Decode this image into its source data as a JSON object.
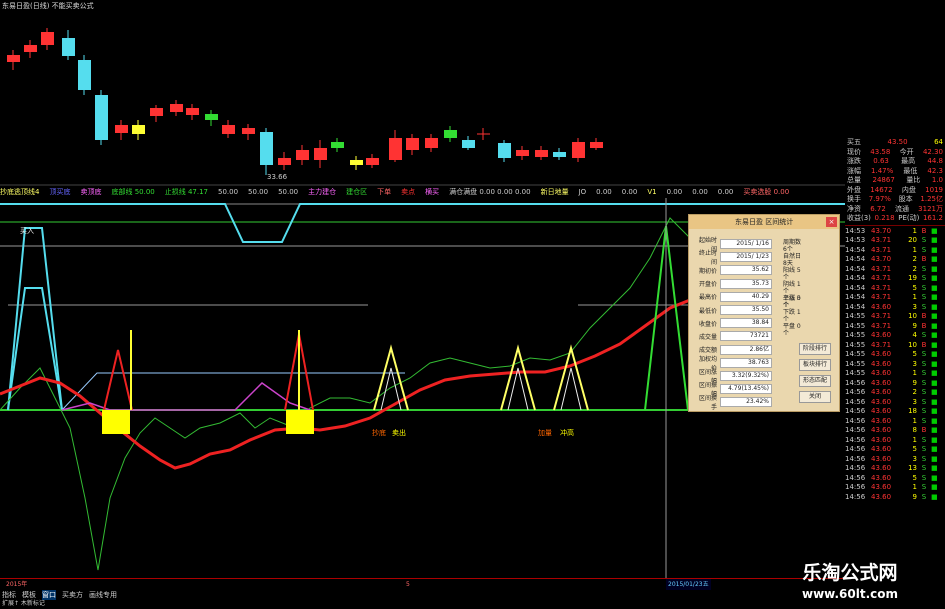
{
  "title": "东易日盈(日线) 不能买卖公式",
  "price_label_low": "33.66",
  "indicator_strip": [
    "抄底逃顶线4",
    "顶买底",
    "卖顶底",
    "底部线 50.00",
    "止损线 47.17",
    "50.00",
    "50.00",
    "50.00",
    "主力建仓",
    "建仓区",
    "下单",
    "卖点",
    "横买",
    "满仓满盘 0.00 0.00 0.00",
    "新日地量",
    "JO",
    "0.00",
    "0.00",
    "V1",
    "0.00",
    "0.00",
    "0.00",
    "买卖选股 0.00"
  ],
  "chart_labels": {
    "buy": "买入",
    "sell1": "抄底",
    "sell2": "卖出",
    "rise": "冲高",
    "lb1": "加量",
    "lb2": "冲高"
  },
  "quote": [
    {
      "k": "买五",
      "v": "43.50",
      "c": "64"
    },
    {
      "k": "现价",
      "v": "43.58",
      "k2": "今开",
      "v2": "42.30"
    },
    {
      "k": "涨跌",
      "v": "0.63",
      "k2": "最高",
      "v2": "44.8"
    },
    {
      "k": "涨幅",
      "v": "1.47%",
      "k2": "最低",
      "v2": "42.3"
    },
    {
      "k": "总量",
      "v": "24867",
      "k2": "量比",
      "v2": "1.0"
    },
    {
      "k": "外盘",
      "v": "14672",
      "k2": "内盘",
      "v2": "1019"
    },
    {
      "k": "换手",
      "v": "7.97%",
      "k2": "股本",
      "v2": "1.25亿"
    },
    {
      "k": "净资",
      "v": "6.72",
      "k2": "流通",
      "v2": "3121万"
    },
    {
      "k": "收益(3)",
      "v": "0.218",
      "k2": "PE(动)",
      "v2": "161.2"
    }
  ],
  "ticks": [
    [
      "14:53",
      "43.70",
      "1",
      "B"
    ],
    [
      "14:53",
      "43.71",
      "20",
      "S"
    ],
    [
      "14:54",
      "43.71",
      "1",
      "S"
    ],
    [
      "14:54",
      "43.70",
      "2",
      "B"
    ],
    [
      "14:54",
      "43.71",
      "2",
      "S"
    ],
    [
      "14:54",
      "43.71",
      "19",
      "S"
    ],
    [
      "14:54",
      "43.71",
      "5",
      "S"
    ],
    [
      "14:54",
      "43.71",
      "1",
      "S"
    ],
    [
      "14:54",
      "43.60",
      "3",
      "S"
    ],
    [
      "14:55",
      "43.71",
      "10",
      "B"
    ],
    [
      "14:55",
      "43.71",
      "9",
      "B"
    ],
    [
      "14:55",
      "43.60",
      "4",
      "S"
    ],
    [
      "14:55",
      "43.71",
      "10",
      "B"
    ],
    [
      "14:55",
      "43.60",
      "5",
      "S"
    ],
    [
      "14:55",
      "43.60",
      "3",
      "S"
    ],
    [
      "14:55",
      "43.60",
      "1",
      "S"
    ],
    [
      "14:56",
      "43.60",
      "9",
      "S"
    ],
    [
      "14:56",
      "43.60",
      "2",
      "S"
    ],
    [
      "14:56",
      "43.60",
      "3",
      "S"
    ],
    [
      "14:56",
      "43.60",
      "18",
      "S"
    ],
    [
      "14:56",
      "43.60",
      "1",
      "S"
    ],
    [
      "14:56",
      "43.60",
      "8",
      "B"
    ],
    [
      "14:56",
      "43.60",
      "1",
      "S"
    ],
    [
      "14:56",
      "43.60",
      "5",
      "S"
    ],
    [
      "14:56",
      "43.60",
      "3",
      "S"
    ],
    [
      "14:56",
      "43.60",
      "13",
      "S"
    ],
    [
      "14:56",
      "43.60",
      "5",
      "S"
    ],
    [
      "14:56",
      "43.60",
      "1",
      "S"
    ],
    [
      "14:56",
      "43.60",
      "9",
      "S"
    ]
  ],
  "dialog": {
    "title": "东易日盈 区间统计",
    "close": "×",
    "fields": [
      {
        "label": "起始时间",
        "value": "2015/ 1/16"
      },
      {
        "label": "终止时间",
        "value": "2015/ 1/23"
      },
      {
        "label": "期初价",
        "value": "35.62"
      },
      {
        "label": "开盘价",
        "value": "35.73"
      },
      {
        "label": "最高价",
        "value": "40.29"
      },
      {
        "label": "最低价",
        "value": "35.50"
      },
      {
        "label": "收盘价",
        "value": "38.84"
      },
      {
        "label": "成交量",
        "value": "73721"
      },
      {
        "label": "成交额",
        "value": "2.86亿"
      },
      {
        "label": "加权均价",
        "value": "38.763"
      },
      {
        "label": "区间涨幅",
        "value": "3.32(9.32%)"
      },
      {
        "label": "区间振幅",
        "value": "4.79(13.45%)"
      },
      {
        "label": "区间换手",
        "value": "23.42%"
      }
    ],
    "side1": [
      "周期数 6个",
      "自然日 8天"
    ],
    "side2": [
      "阳线 5个",
      "阴线 1个",
      "平线 0个"
    ],
    "side3": [
      "上涨 5个",
      "下跌 1个",
      "平盘 0个"
    ],
    "buttons": [
      "阶段排行",
      "板块排行",
      "形态匹配",
      "关闭"
    ]
  },
  "bottom_bar": {
    "left": "2015年",
    "mid": "5",
    "date": "2015/01/23五"
  },
  "tabs": [
    "指标",
    "模板",
    "窗口",
    "买卖方",
    "画线专用"
  ],
  "status": "扩展↑ 木新标记",
  "watermark": {
    "cn": "乐淘公式网",
    "url": "www.60lt.com"
  },
  "colors": {
    "red": "#ff3333",
    "cyan": "#55ddee",
    "yellow": "#ffee33",
    "green": "#33dd33"
  }
}
